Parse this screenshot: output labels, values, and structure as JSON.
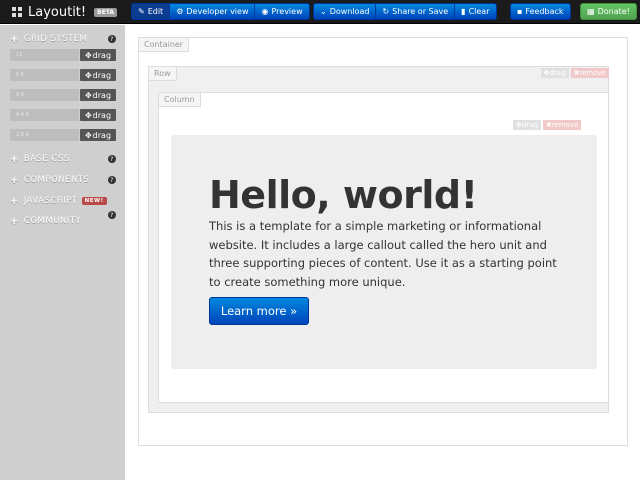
{
  "navbar": {
    "brand": "Layoutit!",
    "beta": "BETA",
    "mode_buttons": [
      {
        "icon": "edit-icon",
        "glyph": "✎",
        "label": "Edit"
      },
      {
        "icon": "developer-icon",
        "glyph": "⚙",
        "label": "Developer view"
      },
      {
        "icon": "eye-icon",
        "glyph": "◉",
        "label": "Preview"
      }
    ],
    "file_buttons": [
      {
        "icon": "download-icon",
        "glyph": "⌄",
        "label": "Download"
      },
      {
        "icon": "share-icon",
        "glyph": "↻",
        "label": "Share or Save"
      },
      {
        "icon": "trash-icon",
        "glyph": "▮",
        "label": "Clear"
      }
    ],
    "feedback": {
      "icon": "comment-icon",
      "glyph": "▪",
      "label": "Feedback"
    },
    "donate": {
      "icon": "gift-icon",
      "glyph": "▦",
      "label": "Donate!"
    }
  },
  "sidebar": {
    "grid_system": {
      "header": "GRID SYSTEM",
      "rows": [
        {
          "value": "12",
          "drag": "drag"
        },
        {
          "value": "6 6",
          "drag": "drag"
        },
        {
          "value": "8 4",
          "drag": "drag"
        },
        {
          "value": "4 4 4",
          "drag": "drag"
        },
        {
          "value": "2 6 4",
          "drag": "drag"
        }
      ]
    },
    "sections": [
      {
        "label": "BASE CSS",
        "badge": ""
      },
      {
        "label": "COMPONENTS",
        "badge": ""
      },
      {
        "label": "JAVASCRIPT",
        "badge": "NEW!"
      },
      {
        "label": "COMMUNITY",
        "badge": ""
      }
    ],
    "help_glyph": "?"
  },
  "canvas": {
    "container_label": "Container",
    "row_label": "Row",
    "column_label": "Column",
    "drag_label": "drag",
    "remove_label": "remove",
    "hero": {
      "title": "Hello, world!",
      "text": "This is a template for a simple marketing or informational website. It includes a large callout called the hero unit and three supporting pieces of content. Use it as a starting point to create something more unique.",
      "button": "Learn more »"
    }
  },
  "colors": {
    "navbar_bg": "#1b1b1b",
    "primary_button": "#0055cc",
    "donate_button": "#51a351",
    "sidebar_bg": "#cfcfcf",
    "new_badge": "#b94a48"
  }
}
